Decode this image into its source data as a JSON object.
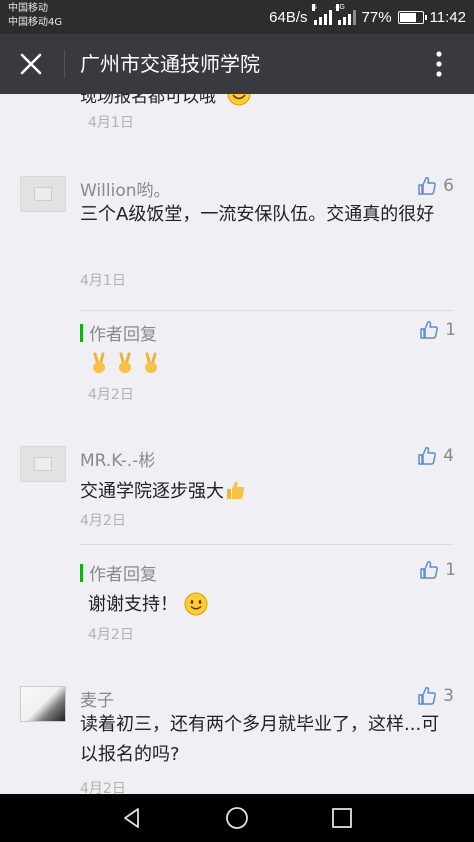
{
  "status_bar": {
    "carrier_1": "中国移动",
    "carrier_2": "中国移动4G",
    "net_speed": "64B/s",
    "signal_tag_1": "G",
    "signal_tag_2": "4G",
    "battery_text": "77%",
    "battery_level": 0.77,
    "time": "11:42"
  },
  "header": {
    "title": "广州市交通技师学院",
    "close_icon": "close-icon",
    "more_icon": "more-vertical-icon"
  },
  "partial_comment": {
    "text": "现场报名都可以哦",
    "date": "4月1日"
  },
  "comments": [
    {
      "name": "Willion哟。",
      "text": "三个A级饭堂，一流安保队伍。交通真的很好",
      "date": "4月1日",
      "likes": "6",
      "reply": {
        "label": "作者回复",
        "likes": "1",
        "date": "4月2日",
        "text": ""
      }
    },
    {
      "name": "MR.K-.-彬",
      "text": "交通学院逐步强大",
      "date": "4月2日",
      "likes": "4",
      "reply": {
        "label": "作者回复",
        "likes": "1",
        "date": "4月2日",
        "text": "谢谢支持！"
      }
    },
    {
      "name": "麦子",
      "text": "读着初三，还有两个多月就毕业了，这样...可以报名的吗?",
      "date": "4月2日",
      "likes": "3"
    }
  ],
  "nav": {
    "back_icon": "back-triangle-icon",
    "home_icon": "home-circle-icon",
    "recent_icon": "recent-square-icon"
  }
}
